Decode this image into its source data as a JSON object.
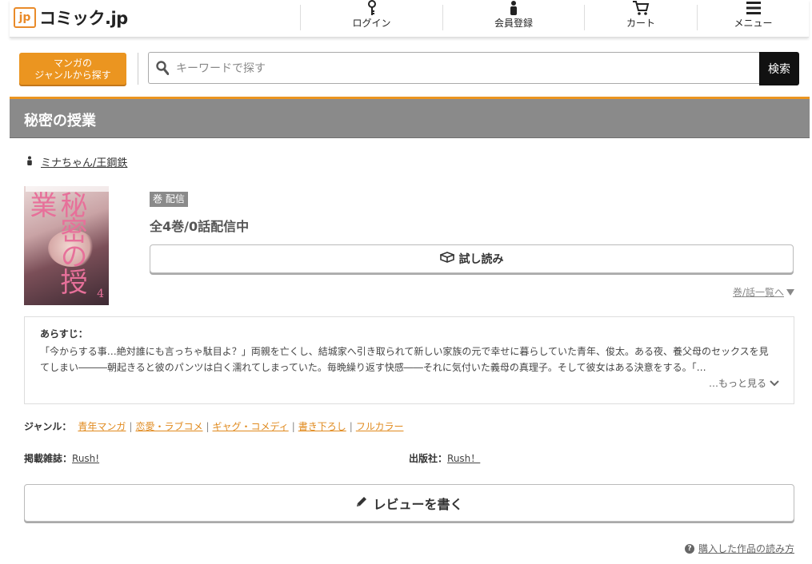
{
  "header": {
    "logo_badge": "jp",
    "logo_text": "コミック.jp",
    "nav": [
      {
        "icon": "key-icon",
        "label": "ログイン"
      },
      {
        "icon": "person-icon",
        "label": "会員登録"
      },
      {
        "icon": "cart-icon",
        "label": "カート"
      },
      {
        "icon": "menu-icon",
        "label": "メニュー"
      }
    ]
  },
  "search": {
    "genre_button_line1": "マンガの",
    "genre_button_line2": "ジャンルから探す",
    "placeholder": "キーワードで探す",
    "button_label": "検索"
  },
  "work": {
    "title": "秘密の授業",
    "author": "ミナちゃん/王鋼鉄",
    "badge": "巻 配信",
    "count_text": "全4巻/0話配信中",
    "trial_label": "試し読み",
    "volume_list_link": "巻/話一覧へ",
    "cover": {
      "title_text": "秘密の授業",
      "volume_number": "4"
    }
  },
  "synopsis": {
    "heading": "あらすじ：",
    "body": "「今からする事…絶対誰にも言っちゃ駄目よ？」両親を亡くし、結城家へ引き取られて新しい家族の元で幸せに暮らしていた青年、俊太。ある夜、養父母のセックスを見てしまい―――朝起きると彼のパンツは白く濡れてしまっていた。毎晩繰り返す快感――それに気付いた義母の真理子。そして彼女はある決意をする。「…",
    "more_label": "…もっと見る"
  },
  "genres": {
    "label": "ジャンル：",
    "items": [
      "青年マンガ",
      "恋愛・ラブコメ",
      "ギャグ・コメディ",
      "書き下ろし",
      "フルカラー"
    ]
  },
  "meta": {
    "magazine_label": "掲載雑誌：",
    "magazine": "Rush!",
    "publisher_label": "出版社：",
    "publisher": "Rush！"
  },
  "review_label": "レビューを書く",
  "help_link": "購入した作品の読み方",
  "colors": {
    "accent": "#eb9520",
    "title_bar": "#8a8a8a",
    "genre_link": "#e08a1e",
    "search_button": "#111111"
  }
}
